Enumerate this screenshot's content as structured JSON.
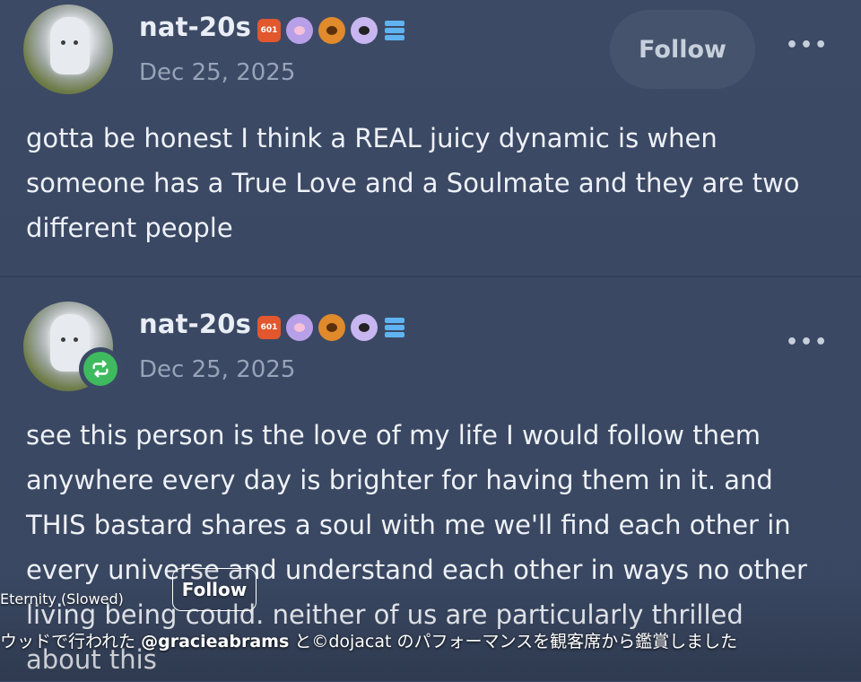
{
  "post1": {
    "username": "nat-20s",
    "date": "Dec 25, 2025",
    "follow_label": "Follow",
    "more_label": "•••",
    "lines": [
      "gotta be honest I think a REAL juicy dynamic is when",
      "someone has a True Love and a Soulmate and they are two",
      "different people"
    ]
  },
  "post2": {
    "username": "nat-20s",
    "date": "Dec 25, 2025",
    "more_label": "•••",
    "lines": [
      "see this person is the love of my life I would follow them",
      "anywhere every day is brighter for having them in it. and",
      "THIS bastard shares a soul with me we'll find each other in",
      "every universe and understand each other in ways no other",
      "living being could. neither of us are particularly thrilled",
      "about this"
    ]
  },
  "badges": {
    "hex_label": "601"
  },
  "overlay": {
    "song": "Eternity (Slowed)",
    "follow_label": "Follow",
    "caption_prefix": "ウッドで行われた ",
    "caption_handle": "@gracieabrams",
    "caption_suffix": " と©dojacat のパフォーマンスを観客席から鑑賞しました"
  },
  "colors": {
    "background": "#3b4a66",
    "reblog_green": "#3fba5f",
    "date_gray": "#98a3b8"
  }
}
